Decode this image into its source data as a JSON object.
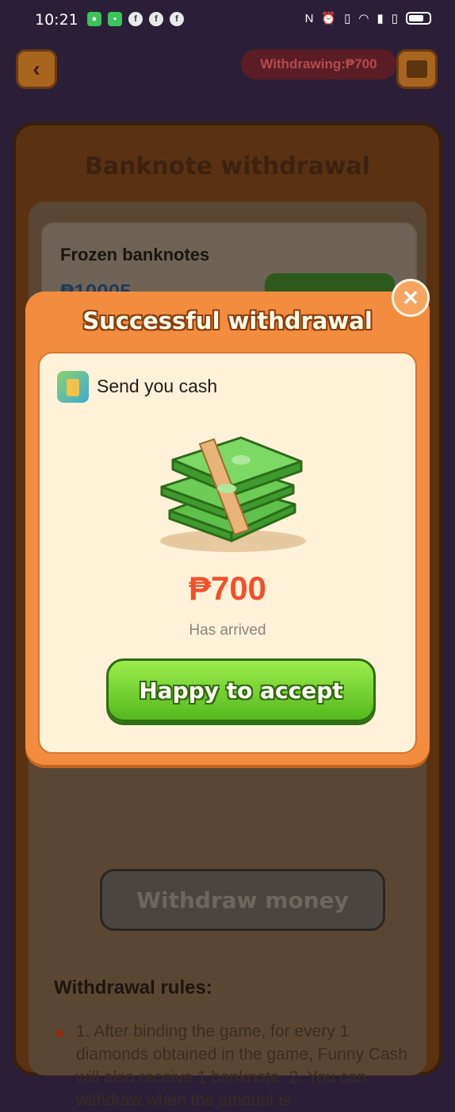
{
  "status_bar": {
    "time": "10:21",
    "notification_icons": [
      "app-icon",
      "app-icon",
      "facebook-icon",
      "facebook-icon",
      "facebook-icon"
    ],
    "right_icons": [
      "nfc-icon",
      "alarm-icon",
      "vibrate-icon",
      "wifi-icon",
      "signal-icon",
      "signal-icon",
      "battery-icon"
    ]
  },
  "header": {
    "withdrawing_label": "Withdrawing:₱700"
  },
  "page": {
    "title": "Banknote withdrawal",
    "frozen_label": "Frozen banknotes",
    "frozen_amount_partial": "₱10005",
    "withdraw_button": "Withdraw money",
    "rules_title": "Withdrawal rules:",
    "rules_text": "1. After binding the game, for every 1 diamonds obtained in the game, Funny Cash will also receive 1 banknote. 2. You can withdraw when the amount is"
  },
  "modal": {
    "title": "Successful withdrawal",
    "send_label": "Send you cash",
    "amount": "₱700",
    "arrived_text": "Has arrived",
    "accept_button": "Happy to accept"
  },
  "colors": {
    "modal_orange": "#f28c3e",
    "amount_red": "#f0502a",
    "accept_green": "#55b81e"
  }
}
